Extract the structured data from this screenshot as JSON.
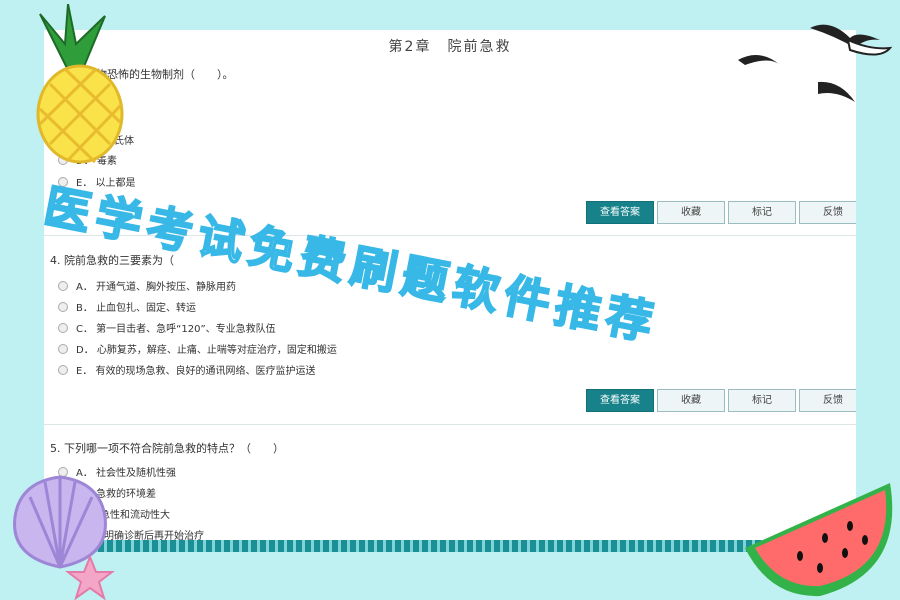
{
  "chapter_title": "第2章　院前急救",
  "q3": {
    "stem": "物恐怖的生物制剂（　　）。",
    "options": [
      {
        "key": "",
        "text": "菌"
      },
      {
        "key": "",
        "text": "次氏体"
      },
      {
        "key": "D．",
        "text": "毒素"
      },
      {
        "key": "E．",
        "text": "以上都是"
      }
    ]
  },
  "buttons": {
    "view_answer": "查看答案",
    "collect": "收藏",
    "mark": "标记",
    "feedback": "反馈"
  },
  "q4": {
    "stem": "4. 院前急救的三要素为（",
    "options": [
      {
        "key": "A．",
        "text": "开通气道、胸外按压、静脉用药"
      },
      {
        "key": "B．",
        "text": "止血包扎、固定、转运"
      },
      {
        "key": "C．",
        "text": "第一目击者、急呼“120”、专业急救队伍"
      },
      {
        "key": "D．",
        "text": "心肺复苏，解痉、止痛、止喘等对症治疗，固定和搬运"
      },
      {
        "key": "E．",
        "text": "有效的现场急救、良好的通讯网络、医疗监护运送"
      }
    ]
  },
  "q5": {
    "stem": "5. 下列哪一项不符合院前急救的特点？（　　）",
    "options": [
      {
        "key": "A．",
        "text": "社会性及随机性强"
      },
      {
        "key": "B．",
        "text": "急救的环境差"
      },
      {
        "key": "",
        "text": "紧急性和流动性大"
      },
      {
        "key": "",
        "text": "先明确诊断后再开始治疗"
      }
    ]
  },
  "overlay_title": "医学考试免费刷题软件推荐",
  "colors": {
    "accent": "#17828a",
    "background": "#bff0f2",
    "overlay_text": "#37b8e6"
  }
}
